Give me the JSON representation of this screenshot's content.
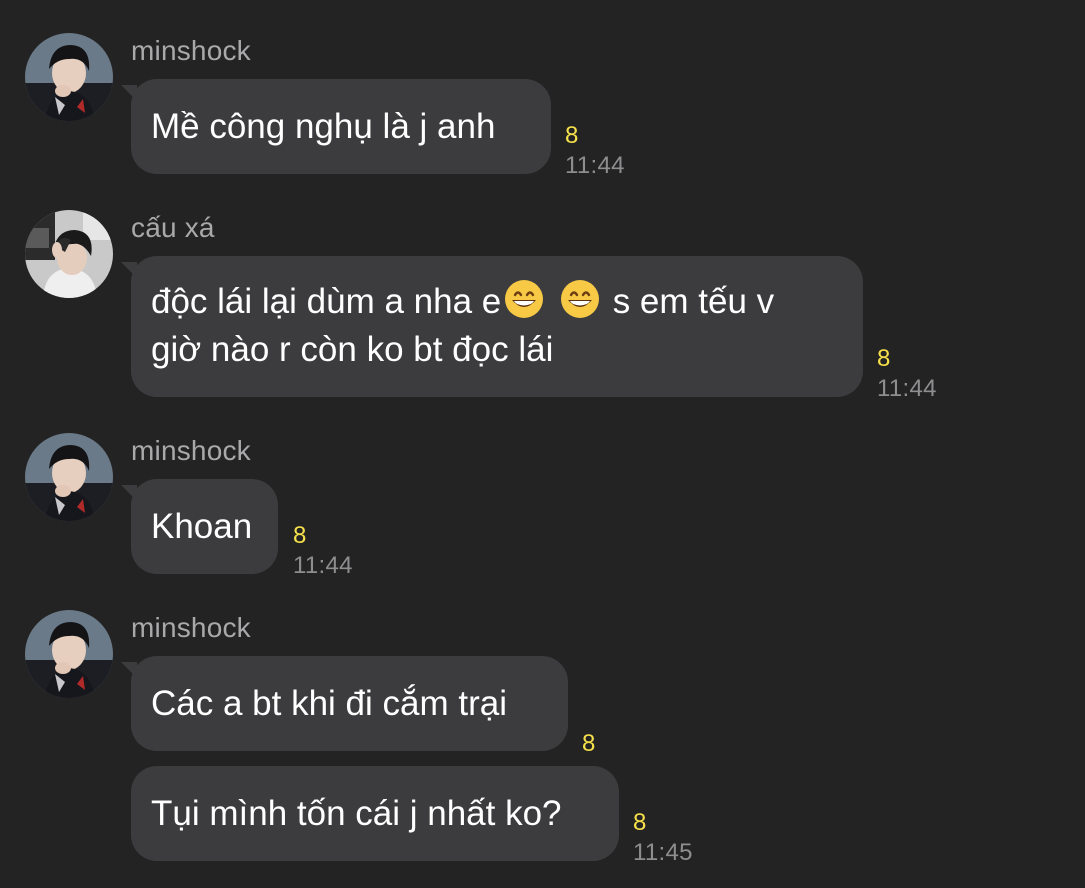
{
  "messages": [
    {
      "sender": "minshock",
      "avatar": "avatar-minshock",
      "text": "Mề công nghụ là j anh",
      "read_count": "8",
      "time": "11:44"
    },
    {
      "sender": "cấu xá",
      "avatar": "avatar-cau-xa",
      "line1_part1": "độc lái lại dùm a nha e",
      "emoji": "grinning-face-with-smiling-eyes",
      "line1_part2": "s em tếu v",
      "line2": "giờ nào r còn ko bt đọc lái",
      "read_count": "8",
      "time": "11:44"
    },
    {
      "sender": "minshock",
      "avatar": "avatar-minshock",
      "text": "Khoan",
      "read_count": "8",
      "time": "11:44"
    },
    {
      "sender": "minshock",
      "avatar": "avatar-minshock",
      "text": "Các a bt khi đi cắm trại",
      "read_count": "8"
    },
    {
      "text": "Tụi mình tốn cái j nhất ko?",
      "read_count": "8",
      "time": "11:45"
    }
  ],
  "colors": {
    "background": "#232323",
    "bubble": "#3c3c3e",
    "sender_name": "#a9a9ab",
    "read_count": "#f6e04b",
    "timestamp": "#8e8e90"
  }
}
